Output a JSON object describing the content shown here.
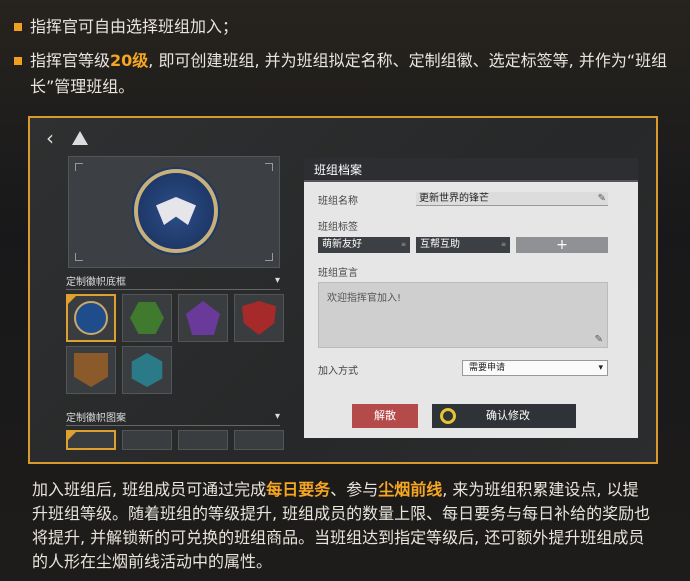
{
  "bullets": [
    {
      "text": "指挥官可自由选择班组加入；"
    },
    {
      "pre": "指挥官等级",
      "highlight": "20级",
      "post": ", 即可创建班组, 并为班组拟定名称、定制组徽、选定标签等, 并作为“班组长”管理班组。"
    }
  ],
  "ui": {
    "section_frame": "定制徽帜底框",
    "section_pattern": "定制徽帜图案",
    "panel_title": "班组档案",
    "name_label": "班组名称",
    "name_value": "更新世界的锋芒",
    "tags_label": "班组标签",
    "tag1": "萌新友好",
    "tag2": "互帮互助",
    "tag_add": "+",
    "motto_label": "班组宣言",
    "motto_placeholder": "欢迎指挥官加入!",
    "join_label": "加入方式",
    "join_value": "需要申请",
    "dismiss_btn": "解散",
    "confirm_btn": "确认修改",
    "back_icon": "‹"
  },
  "body": {
    "p1": "加入班组后, 班组成员可通过完成",
    "hl1": "每日要务",
    "p2": "、参与",
    "hl2": "尘烟前线",
    "p3": ", 来为班组积累建设点, 以提升班组等级。随着班组的等级提升, 班组成员的数量上限、每日要务与每日补给的奖励也将提升, 并解锁新的可兑换的班组商品。当班组达到指定等级后, 还可额外提升班组成员的人形在尘烟前线活动中的属性。"
  },
  "colors": {
    "accent": "#f5a623",
    "frame_border": "#d89a2c"
  }
}
